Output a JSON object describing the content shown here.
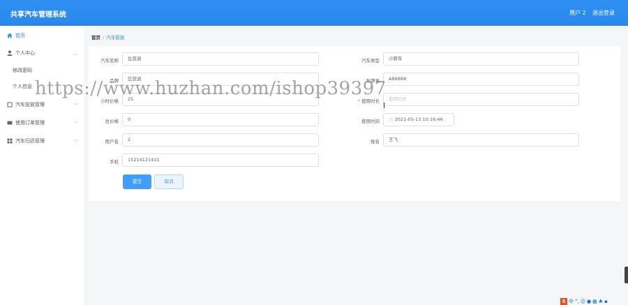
{
  "header": {
    "title": "共享汽车管理系统",
    "user": "用户 2",
    "logout": "退出登录"
  },
  "sidebar": {
    "items": [
      {
        "label": "首页",
        "icon": "home-icon",
        "active": true
      },
      {
        "label": "个人中心",
        "icon": "user-icon",
        "expanded": true
      },
      {
        "label": "汽车投放管理",
        "icon": "box-icon"
      },
      {
        "label": "使用订单管理",
        "icon": "list-icon"
      },
      {
        "label": "汽车归还管理",
        "icon": "grid-icon"
      }
    ],
    "subitems": [
      "修改密码",
      "个人信息"
    ]
  },
  "breadcrumb": {
    "home": "首页",
    "separator": "/",
    "current": "汽车投放"
  },
  "form": {
    "car_name": {
      "label": "汽车名称",
      "value": "比亚迪"
    },
    "car_type": {
      "label": "汽车类型",
      "value": "小轿车"
    },
    "brand": {
      "label": "品牌",
      "value": "比亚迪"
    },
    "plate": {
      "label": "车牌号",
      "value": "A88888"
    },
    "hourly_price": {
      "label": "小时价格",
      "value": "25"
    },
    "duration": {
      "label": "使用时长",
      "placeholder": "使用时长",
      "required_mark": "*"
    },
    "total_price": {
      "label": "总价格",
      "value": "0"
    },
    "use_time": {
      "label": "使用时间",
      "value": "2021-05-13 10:16:46"
    },
    "username": {
      "label": "用户名",
      "value": "2"
    },
    "name": {
      "label": "姓名",
      "value": "王飞"
    },
    "phone": {
      "label": "手机",
      "value": "15214121411"
    },
    "submit": "提交",
    "cancel": "取消"
  },
  "watermark": "https://www.huzhan.com/ishop39397",
  "tray": {
    "ime": "S",
    "lang": "中"
  },
  "colors": {
    "primary": "#409eff",
    "header": "#2d8cf0",
    "required": "#f56c6c"
  }
}
